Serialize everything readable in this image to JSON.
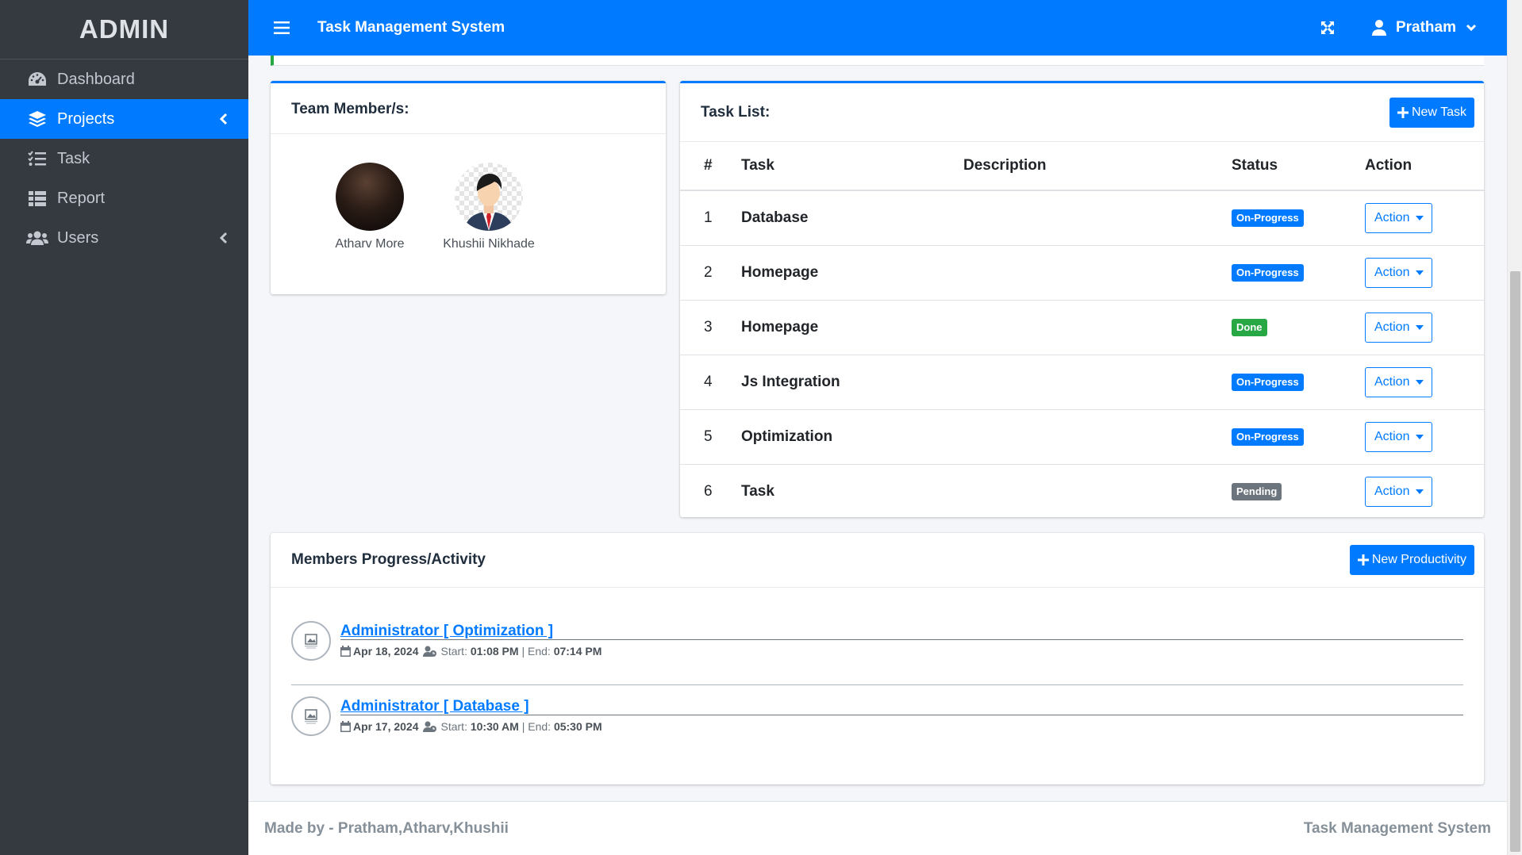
{
  "brand": "ADMIN",
  "sidebar": {
    "items": [
      {
        "label": "Dashboard",
        "icon": "tachometer-icon",
        "active": false
      },
      {
        "label": "Projects",
        "icon": "layers-icon",
        "active": true
      },
      {
        "label": "Task",
        "icon": "tasks-icon",
        "active": false
      },
      {
        "label": "Report",
        "icon": "table-icon",
        "active": false
      },
      {
        "label": "Users",
        "icon": "users-icon",
        "active": false
      }
    ]
  },
  "topbar": {
    "title": "Task Management System",
    "user": "Pratham"
  },
  "team": {
    "title": "Team Member/s:",
    "members": [
      {
        "name": "Atharv More"
      },
      {
        "name": "Khushii Nikhade"
      }
    ]
  },
  "tasks": {
    "title": "Task List:",
    "new_button": "New Task",
    "headers": {
      "num": "#",
      "task": "Task",
      "description": "Description",
      "status": "Status",
      "action": "Action"
    },
    "rows": [
      {
        "num": "1",
        "task": "Database",
        "description": "",
        "status": "On-Progress",
        "action": "Action"
      },
      {
        "num": "2",
        "task": "Homepage",
        "description": "",
        "status": "On-Progress",
        "action": "Action"
      },
      {
        "num": "3",
        "task": "Homepage",
        "description": "",
        "status": "Done",
        "action": "Action"
      },
      {
        "num": "4",
        "task": "Js Integration",
        "description": "",
        "status": "On-Progress",
        "action": "Action"
      },
      {
        "num": "5",
        "task": "Optimization",
        "description": "",
        "status": "On-Progress",
        "action": "Action"
      },
      {
        "num": "6",
        "task": "Task",
        "description": "",
        "status": "Pending",
        "action": "Action"
      }
    ]
  },
  "progress": {
    "title": "Members Progress/Activity",
    "new_button": "New Productivity",
    "activities": [
      {
        "title": "Administrator [ Optimization ]",
        "date": "Apr 18, 2024",
        "start_label": "Start:",
        "start": "01:08 PM",
        "end_label": "End:",
        "end": "07:14 PM"
      },
      {
        "title": "Administrator [ Database ]",
        "date": "Apr 17, 2024",
        "start_label": "Start:",
        "start": "10:30 AM",
        "end_label": "End:",
        "end": "05:30 PM"
      }
    ]
  },
  "footer": {
    "left": "Made by - Pratham,Atharv,Khushii",
    "right": "Task Management System"
  },
  "colors": {
    "primary": "#007bff",
    "sidebar_bg": "#343a40",
    "success": "#28a745",
    "secondary": "#6c757d"
  }
}
